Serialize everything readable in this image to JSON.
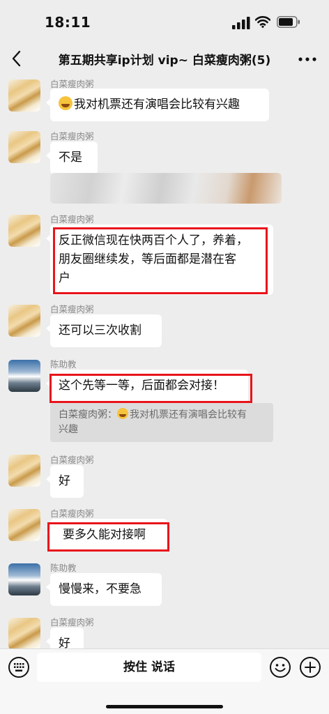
{
  "status_bar": {
    "time": "18:11"
  },
  "header": {
    "title": "第五期共享ip计划 vip~ 白菜瘦肉粥(5)"
  },
  "messages": [
    {
      "sender": "白菜瘦肉粥",
      "text": "我对机票还有演唱会比较有兴趣",
      "emoji": "grin-emoji"
    },
    {
      "sender": "白菜瘦肉粥",
      "text": "不是",
      "image": "blurred-image"
    },
    {
      "sender": "白菜瘦肉粥",
      "text_lines": [
        "反正微信现在快两百个人了，养着，",
        "朋友圈继续发，等后面都是潜在客",
        "户"
      ],
      "highlighted": true
    },
    {
      "sender": "白菜瘦肉粥",
      "text": "还可以三次收割"
    },
    {
      "sender": "陈助教",
      "text": "这个先等一等，后面都会对接！",
      "highlighted": true,
      "quote_lines": [
        "白菜瘦肉粥：我对机票还有演唱会比较有",
        "兴趣"
      ]
    },
    {
      "sender": "白菜瘦肉粥",
      "text": "好"
    },
    {
      "sender": "白菜瘦肉粥",
      "text": "要多久能对接啊",
      "highlighted": true
    },
    {
      "sender": "陈助教",
      "text": "慢慢来，不要急"
    },
    {
      "sender": "白菜瘦肉粥",
      "text": "好"
    }
  ],
  "input_bar": {
    "voice_label": "按住 说话"
  },
  "colors": {
    "highlight": "#e8141b",
    "background": "#ededed",
    "bubble": "#ffffff"
  }
}
